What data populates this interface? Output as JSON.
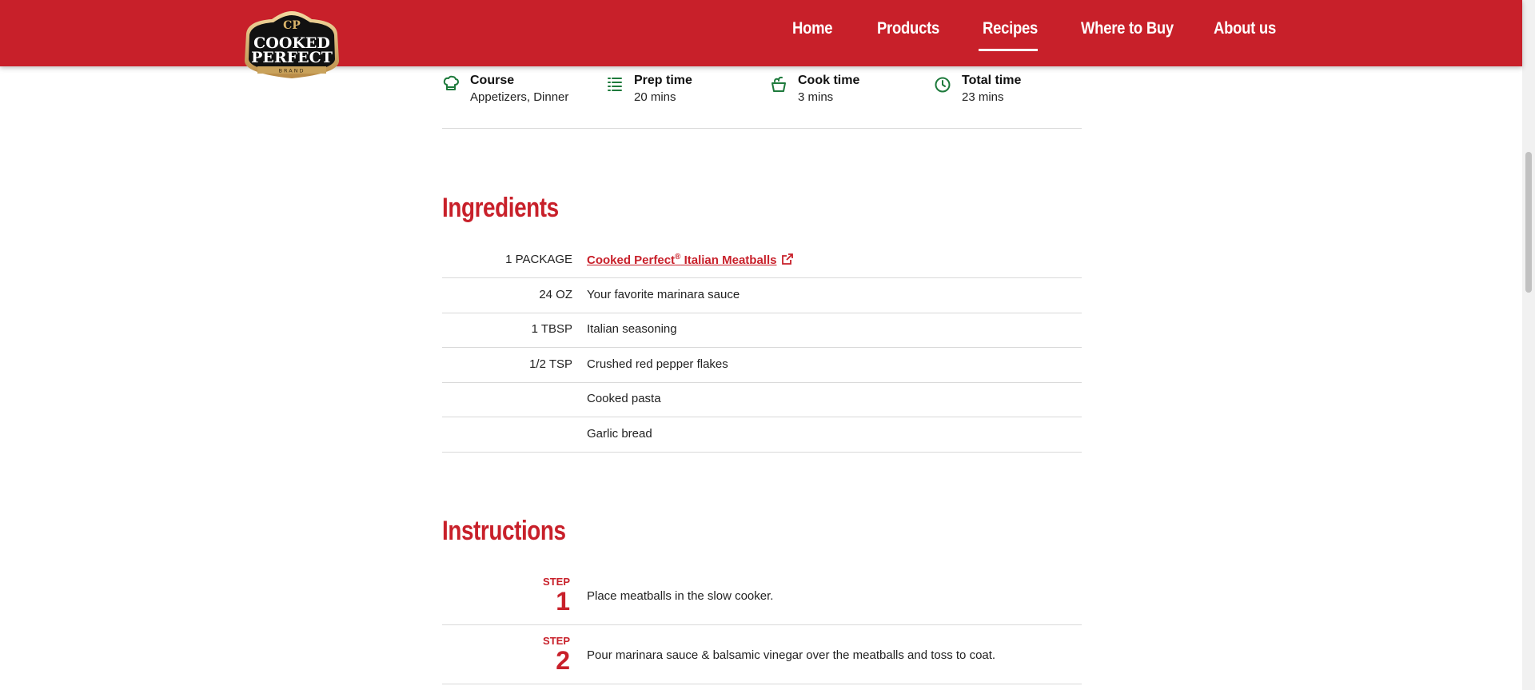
{
  "brand": {
    "logo_text_line1": "COOKED",
    "logo_text_line2": "PERFECT",
    "logo_text_line3": "BRAND"
  },
  "nav": [
    {
      "label": "Home"
    },
    {
      "label": "Products"
    },
    {
      "label": "Recipes",
      "active": true
    },
    {
      "label": "Where to Buy"
    },
    {
      "label": "About us"
    }
  ],
  "meta": [
    {
      "label": "Course",
      "value": "Appetizers, Dinner",
      "icon": "chef-hat-icon"
    },
    {
      "label": "Prep time",
      "value": "20 mins",
      "icon": "list-icon"
    },
    {
      "label": "Cook time",
      "value": "3 mins",
      "icon": "pot-icon"
    },
    {
      "label": "Total time",
      "value": "23 mins",
      "icon": "clock-icon"
    }
  ],
  "ingredients": {
    "title": "Ingredients",
    "items": [
      {
        "qty": "1 PACKAGE",
        "name": "Cooked Perfect",
        "reg": "®",
        "name_rest": " Italian Meatballs",
        "link": true
      },
      {
        "qty": "24 OZ",
        "name": "Your favorite marinara sauce"
      },
      {
        "qty": "1 TBSP",
        "name": "Italian seasoning"
      },
      {
        "qty": "1/2 TSP",
        "name": "Crushed red pepper flakes"
      },
      {
        "qty": "",
        "name": "Cooked pasta"
      },
      {
        "qty": "",
        "name": "Garlic bread"
      }
    ]
  },
  "instructions": {
    "title": "Instructions",
    "step_label": "STEP",
    "steps": [
      {
        "num": "1",
        "text": "Place meatballs in the slow cooker."
      },
      {
        "num": "2",
        "text": "Pour marinara sauce & balsamic vinegar over the meatballs and toss to coat."
      }
    ]
  },
  "colors": {
    "brand_red": "#c8202a",
    "icon_green": "#1e7a3c",
    "divider": "#d9d9d9"
  }
}
